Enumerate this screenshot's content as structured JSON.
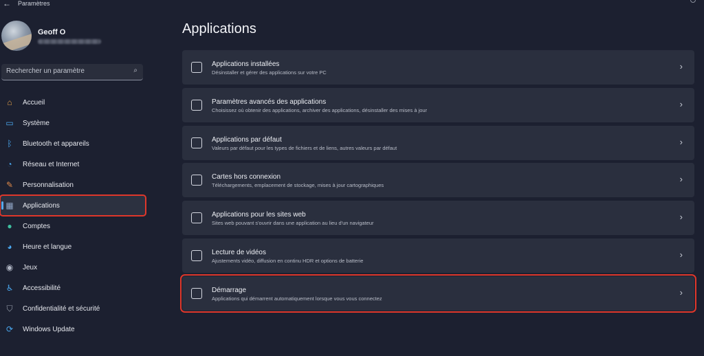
{
  "window": {
    "title": "Paramètres"
  },
  "user": {
    "name": "Geoff O"
  },
  "search": {
    "placeholder": "Rechercher un paramètre"
  },
  "sidebar": {
    "items": [
      {
        "label": "Accueil",
        "icon": "home-icon",
        "color": "#e3a04a"
      },
      {
        "label": "Système",
        "icon": "monitor-icon",
        "color": "#4aa8f0"
      },
      {
        "label": "Bluetooth et appareils",
        "icon": "bluetooth-icon",
        "color": "#4aa8f0"
      },
      {
        "label": "Réseau et Internet",
        "icon": "wifi-icon",
        "color": "#4aa8f0"
      },
      {
        "label": "Personnalisation",
        "icon": "brush-icon",
        "color": "#e08a4a"
      },
      {
        "label": "Applications",
        "icon": "apps-icon",
        "color": "#8fa4c4"
      },
      {
        "label": "Comptes",
        "icon": "person-icon",
        "color": "#3fc0a0"
      },
      {
        "label": "Heure et langue",
        "icon": "globe-clock-icon",
        "color": "#4aa8f0"
      },
      {
        "label": "Jeux",
        "icon": "gamepad-icon",
        "color": "#b0b6c4"
      },
      {
        "label": "Accessibilité",
        "icon": "accessibility-icon",
        "color": "#4aa8f0"
      },
      {
        "label": "Confidentialité et sécurité",
        "icon": "shield-icon",
        "color": "#9aa0ae"
      },
      {
        "label": "Windows Update",
        "icon": "update-icon",
        "color": "#4aa8f0"
      }
    ],
    "active_index": 5
  },
  "main": {
    "title": "Applications",
    "cards": [
      {
        "title": "Applications installées",
        "desc": "Désinstaller et gérer des applications sur votre PC",
        "icon": "list-icon"
      },
      {
        "title": "Paramètres avancés des applications",
        "desc": "Choisissez où obtenir des applications, archiver des applications, désinstaller des mises à jour",
        "icon": "advanced-apps-icon"
      },
      {
        "title": "Applications par défaut",
        "desc": "Valeurs par défaut pour les types de fichiers et de liens, autres valeurs par défaut",
        "icon": "default-apps-icon"
      },
      {
        "title": "Cartes hors connexion",
        "desc": "Téléchargements, emplacement de stockage, mises à jour cartographiques",
        "icon": "map-icon"
      },
      {
        "title": "Applications pour les sites web",
        "desc": "Sites web pouvant s'ouvrir dans une application au lieu d'un navigateur",
        "icon": "web-app-icon"
      },
      {
        "title": "Lecture de vidéos",
        "desc": "Ajustements vidéo, diffusion en continu HDR et options de batterie",
        "icon": "video-icon"
      },
      {
        "title": "Démarrage",
        "desc": "Applications qui démarrent automatiquement lorsque vous vous connectez",
        "icon": "startup-icon"
      }
    ]
  },
  "colors": {
    "background": "#1c2030",
    "card": "#2a2f3e",
    "highlight": "#e0372a",
    "accent": "#5aa8ea"
  }
}
